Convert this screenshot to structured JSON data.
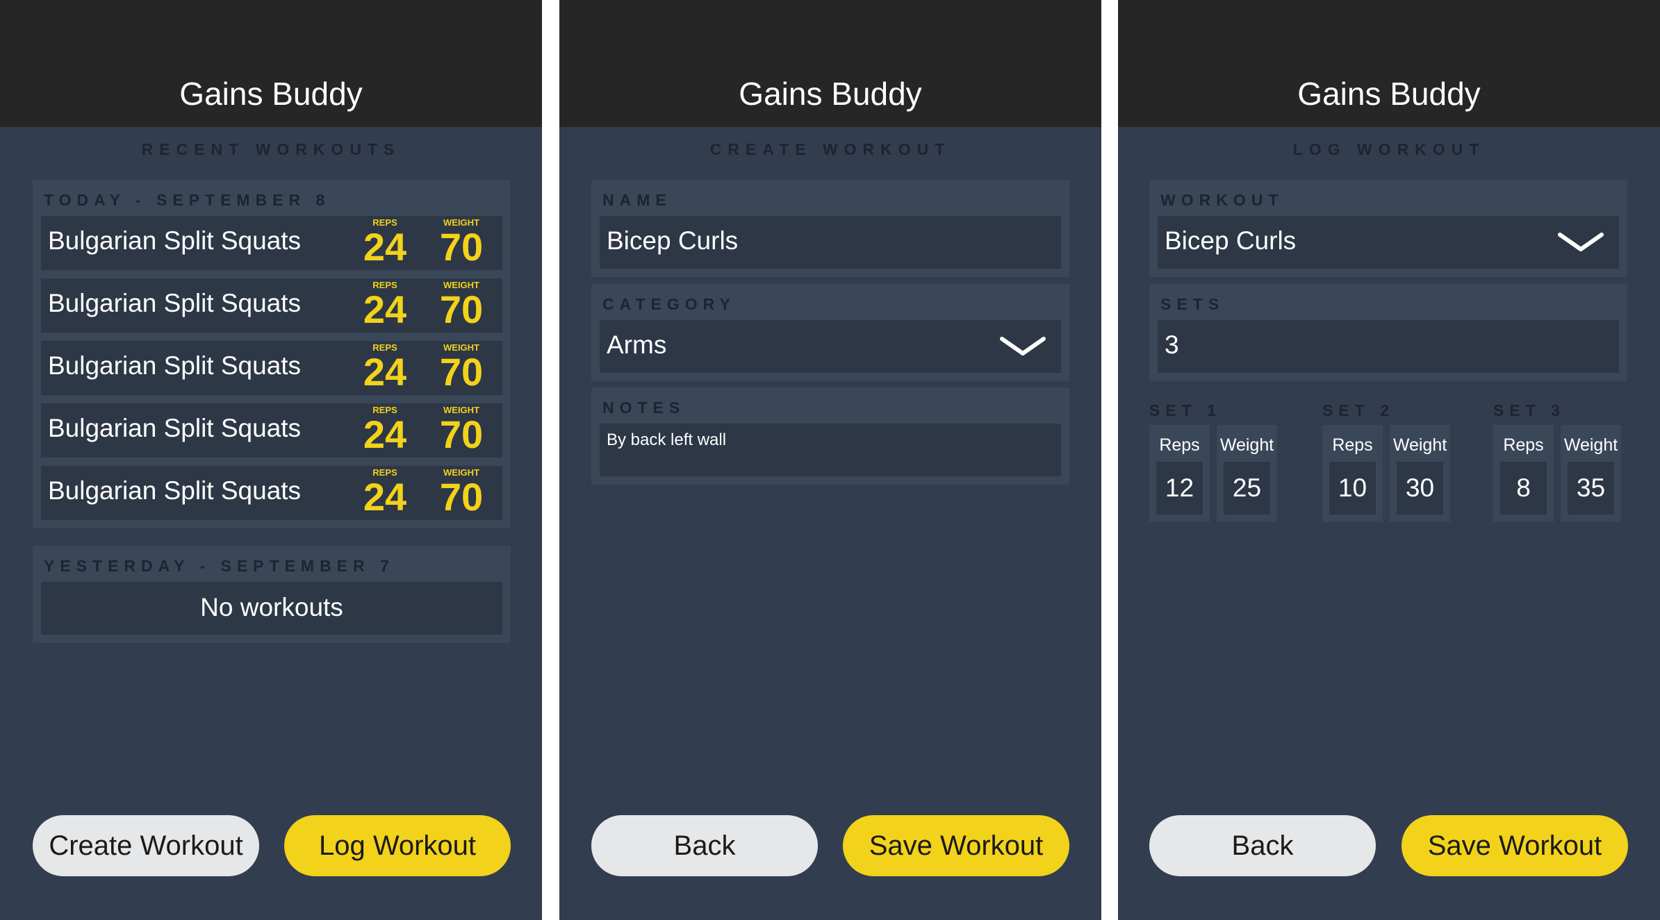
{
  "app_title": "Gains Buddy",
  "colors": {
    "accent": "#f2d21b",
    "background": "#323d4f",
    "topbar": "#262626",
    "panel": "#3a4759",
    "field": "#2d3746",
    "light_button": "#e6e7e8"
  },
  "screen1": {
    "section_title": "RECENT WORKOUTS",
    "today": {
      "label": "TODAY - SEPTEMBER 8",
      "rows": [
        {
          "name": "Bulgarian Split Squats",
          "reps_label": "REPS",
          "reps": "24",
          "weight_label": "WEIGHT",
          "weight": "70"
        },
        {
          "name": "Bulgarian Split Squats",
          "reps_label": "REPS",
          "reps": "24",
          "weight_label": "WEIGHT",
          "weight": "70"
        },
        {
          "name": "Bulgarian Split Squats",
          "reps_label": "REPS",
          "reps": "24",
          "weight_label": "WEIGHT",
          "weight": "70"
        },
        {
          "name": "Bulgarian Split Squats",
          "reps_label": "REPS",
          "reps": "24",
          "weight_label": "WEIGHT",
          "weight": "70"
        },
        {
          "name": "Bulgarian Split Squats",
          "reps_label": "REPS",
          "reps": "24",
          "weight_label": "WEIGHT",
          "weight": "70"
        }
      ]
    },
    "yesterday": {
      "label": "YESTERDAY - SEPTEMBER 7",
      "empty_text": "No workouts"
    },
    "buttons": {
      "create": "Create Workout",
      "log": "Log Workout"
    }
  },
  "screen2": {
    "section_title": "CREATE WORKOUT",
    "name": {
      "label": "NAME",
      "value": "Bicep Curls"
    },
    "category": {
      "label": "CATEGORY",
      "value": "Arms",
      "icon": "chevron-down-icon"
    },
    "notes": {
      "label": "NOTES",
      "value": "By back left wall"
    },
    "buttons": {
      "back": "Back",
      "save": "Save Workout"
    }
  },
  "screen3": {
    "section_title": "LOG WORKOUT",
    "workout": {
      "label": "WORKOUT",
      "value": "Bicep Curls",
      "icon": "chevron-down-icon"
    },
    "sets": {
      "label": "SETS",
      "value": "3"
    },
    "set_entries": [
      {
        "label": "SET 1",
        "reps_label": "Reps",
        "reps": "12",
        "weight_label": "Weight",
        "weight": "25"
      },
      {
        "label": "SET 2",
        "reps_label": "Reps",
        "reps": "10",
        "weight_label": "Weight",
        "weight": "30"
      },
      {
        "label": "SET 3",
        "reps_label": "Reps",
        "reps": "8",
        "weight_label": "Weight",
        "weight": "35"
      }
    ],
    "buttons": {
      "back": "Back",
      "save": "Save Workout"
    }
  }
}
